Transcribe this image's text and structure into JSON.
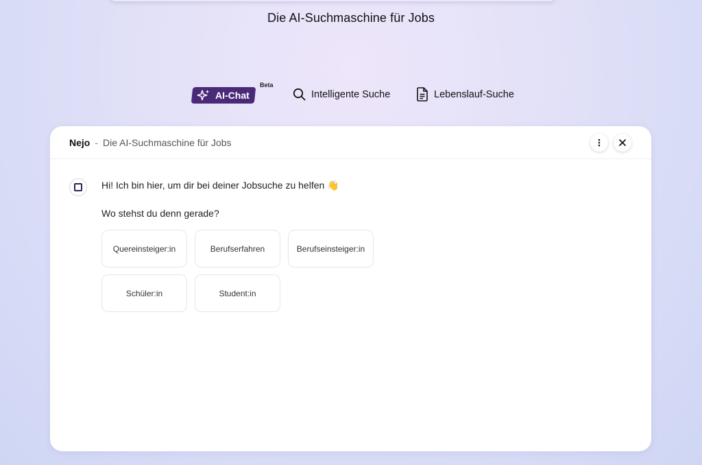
{
  "page": {
    "title": "Die AI-Suchmaschine für Jobs"
  },
  "tabs": {
    "ai_chat": {
      "label": "AI-Chat",
      "badge": "Beta"
    },
    "smart_search": {
      "label": "Intelligente Suche"
    },
    "cv_search": {
      "label": "Lebenslauf-Suche"
    }
  },
  "chat": {
    "brand": "Nejo",
    "separator": "-",
    "subtitle": "Die AI-Suchmaschine für Jobs",
    "greeting": "Hi! Ich bin hier, um dir bei deiner Jobsuche zu helfen 👋",
    "question": "Wo stehst du denn gerade?",
    "options": [
      "Quereinsteiger:in",
      "Berufserfahren",
      "Berufseinsteiger:in",
      "Schüler:in",
      "Student:in"
    ]
  },
  "colors": {
    "accent": "#4a2a78",
    "background_top": "#eee6fb",
    "background_edge": "#cfd6f4"
  },
  "icons": {
    "ai_chat": "sparkles-icon",
    "smart_search": "search-icon",
    "cv_search": "document-icon",
    "menu": "more-vertical-icon",
    "close": "close-icon",
    "avatar": "bot-square-icon"
  }
}
